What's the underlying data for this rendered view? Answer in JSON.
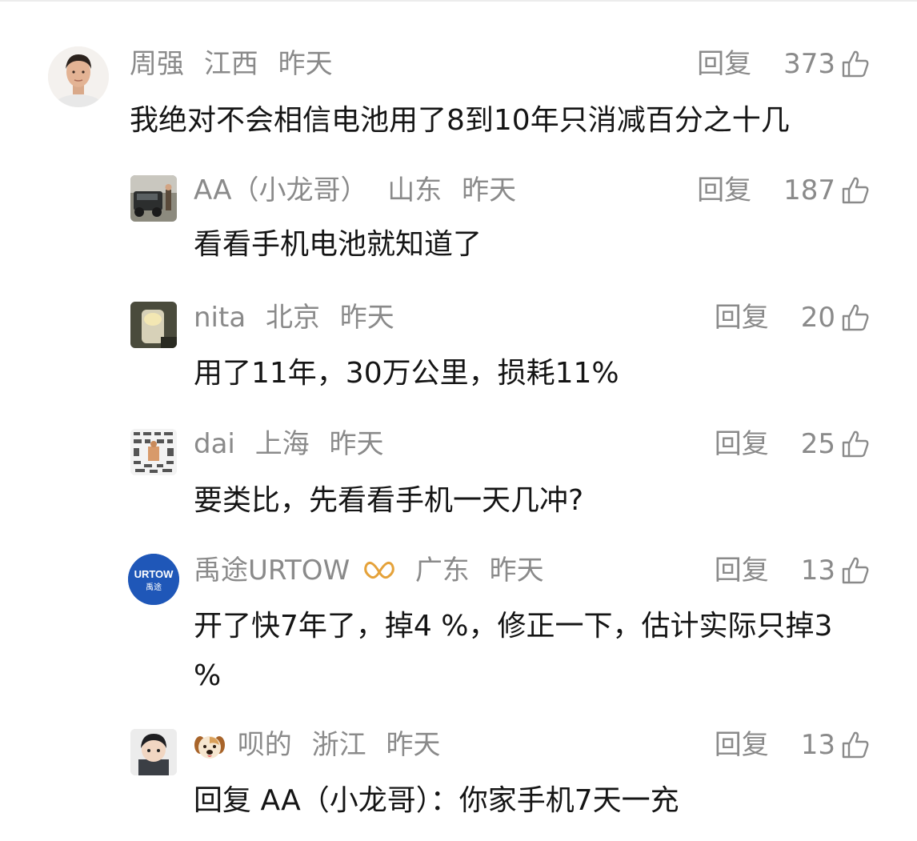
{
  "comments": [
    {
      "author": "周强",
      "location": "江西",
      "time": "昨天",
      "reply_label": "回复",
      "likes": "373",
      "text": "我绝对不会相信电池用了8到10年只消减百分之十几",
      "avatar_icon": "person-avatar"
    },
    {
      "author": "AA（小龙哥）",
      "location": "山东",
      "time": "昨天",
      "reply_label": "回复",
      "likes": "187",
      "text": "看看手机电池就知道了",
      "avatar_icon": "car-photo-avatar"
    },
    {
      "author": "nita",
      "location": "北京",
      "time": "昨天",
      "reply_label": "回复",
      "likes": "20",
      "text": "用了11年，30万公里，损耗11%",
      "avatar_icon": "candle-photo-avatar"
    },
    {
      "author": "dai",
      "location": "上海",
      "time": "昨天",
      "reply_label": "回复",
      "likes": "25",
      "text": "要类比，先看看手机一天几冲?",
      "avatar_icon": "tools-grid-avatar"
    },
    {
      "author": "禹途URTOW",
      "location": "广东",
      "time": "昨天",
      "reply_label": "回复",
      "likes": "13",
      "text": "开了快7年了，掉4 %，修正一下，估计实际只掉3 %",
      "avatar_icon": "urtow-logo-avatar",
      "avatar_logo_text": "URTOW",
      "avatar_logo_sub": "禹途",
      "badge_icon": "butterfly-badge-icon"
    },
    {
      "author": "呗的",
      "location": "浙江",
      "time": "昨天",
      "reply_label": "回复",
      "likes": "13",
      "text": "回复 AA（小龙哥）：你家手机7天一充",
      "avatar_icon": "cartoon-boy-avatar",
      "prefix_icon": "dog-emoji-icon"
    }
  ],
  "colors": {
    "meta": "#8a8a8a",
    "text": "#151515",
    "urtow_blue": "#1f57b8",
    "badge_gold": "#e5a23a"
  }
}
